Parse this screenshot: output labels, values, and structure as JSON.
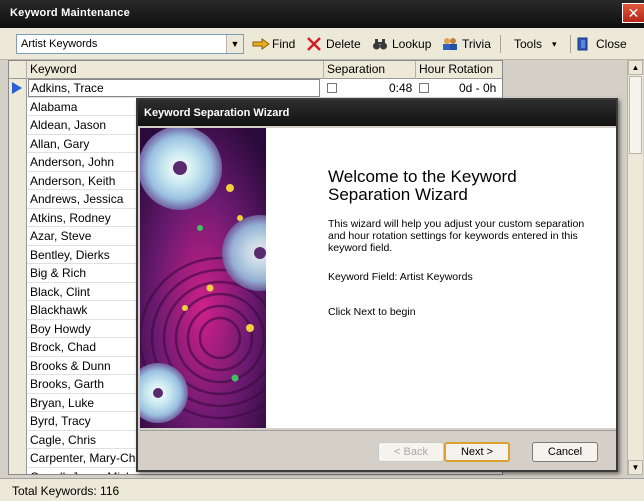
{
  "window": {
    "title": "Keyword Maintenance",
    "close_glyph": "✕"
  },
  "toolbar": {
    "combo_value": "Artist Keywords",
    "find_label": "Find",
    "delete_label": "Delete",
    "lookup_label": "Lookup",
    "trivia_label": "Trivia",
    "tools_label": "Tools",
    "tools_arrow": "▾",
    "close_label": "Close"
  },
  "grid": {
    "headers": {
      "keyword": "Keyword",
      "separation": "Separation",
      "hour_rotation": "Hour Rotation"
    },
    "first_row": {
      "keyword": "Adkins, Trace",
      "separation": "0:48",
      "hour_rotation": "0d - 0h"
    },
    "rows": [
      "Alabama",
      "Aldean, Jason",
      "Allan, Gary",
      "Anderson, John",
      "Anderson, Keith",
      "Andrews, Jessica",
      "Atkins, Rodney",
      "Azar, Steve",
      "Bentley, Dierks",
      "Big & Rich",
      "Black, Clint",
      "Blackhawk",
      "Boy Howdy",
      "Brock, Chad",
      "Brooks & Dunn",
      "Brooks, Garth",
      "Bryan, Luke",
      "Byrd, Tracy",
      "Cagle, Chris",
      "Carpenter, Mary-Ch",
      "Carroll, Jason Mich"
    ]
  },
  "status": {
    "text": "Total Keywords: 116"
  },
  "wizard": {
    "title": "Keyword Separation Wizard",
    "heading": "Welcome to the Keyword Separation Wizard",
    "description": "This wizard will help you adjust your custom separation and hour rotation settings for keywords entered in this keyword field.",
    "field_line": "Keyword Field: Artist Keywords",
    "click_line": "Click Next to begin",
    "back_label": "< Back",
    "next_label": "Next >",
    "cancel_label": "Cancel"
  },
  "colors": {
    "accent_blue": "#2a5fd0",
    "title_bar": "#111111",
    "close_red": "#c0341f",
    "default_btn_border": "#e0a030"
  }
}
